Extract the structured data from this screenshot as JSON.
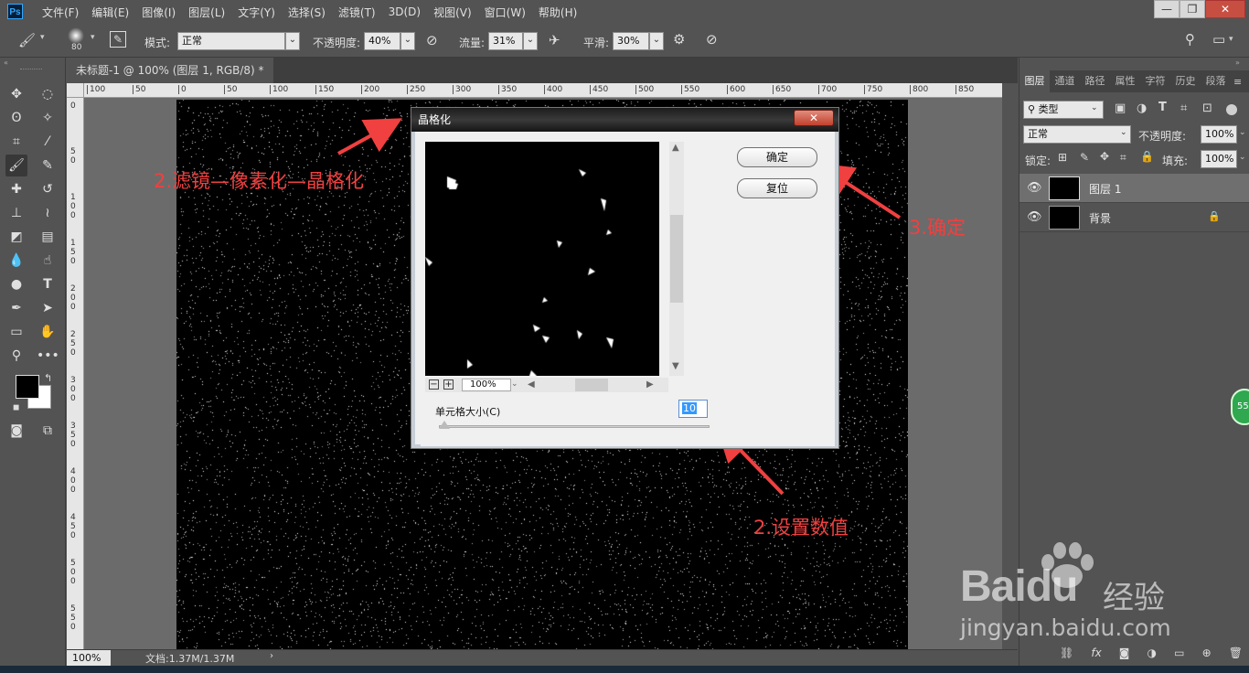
{
  "app": {
    "logo": "Ps",
    "menus": [
      "文件(F)",
      "编辑(E)",
      "图像(I)",
      "图层(L)",
      "文字(Y)",
      "选择(S)",
      "滤镜(T)",
      "3D(D)",
      "视图(V)",
      "窗口(W)",
      "帮助(H)"
    ],
    "window_controls": {
      "minimize": "—",
      "restore": "❐",
      "close": "✕"
    }
  },
  "options_bar": {
    "brush_size": "80",
    "mode_label": "模式:",
    "mode_value": "正常",
    "opacity_label": "不透明度:",
    "opacity_value": "40%",
    "flow_label": "流量:",
    "flow_value": "31%",
    "smooth_label": "平滑:",
    "smooth_value": "30%"
  },
  "document": {
    "tab_title": "未标题-1 @ 100% (图层 1, RGB/8) *",
    "tab_close": "×",
    "zoom": "100%",
    "doc_info": "文档:1.37M/1.37M",
    "ruler_top_labels": [
      "100",
      "50",
      "0",
      "50",
      "100",
      "150",
      "200",
      "250",
      "300",
      "350",
      "400",
      "450",
      "500",
      "550",
      "600",
      "650",
      "700",
      "750",
      "800",
      "850"
    ],
    "ruler_left_labels": [
      "0",
      "5\n0",
      "1\n0\n0",
      "1\n5\n0",
      "2\n0\n0",
      "2\n5\n0",
      "3\n0\n0",
      "3\n5\n0",
      "4\n0\n0",
      "4\n5\n0",
      "5\n0\n0",
      "5\n5\n0"
    ]
  },
  "layers_panel": {
    "tabs": [
      "图层",
      "通道",
      "路径",
      "属性",
      "字符",
      "历史",
      "段落"
    ],
    "filter_label": "类型",
    "blend_mode": "正常",
    "opacity_label": "不透明度:",
    "opacity_value": "100%",
    "lock_label": "锁定:",
    "fill_label": "填充:",
    "fill_value": "100%",
    "layers": [
      {
        "name": "图层 1",
        "selected": true,
        "locked": false
      },
      {
        "name": "背景",
        "selected": false,
        "locked": true
      }
    ]
  },
  "dialog": {
    "title": "晶格化",
    "ok_label": "确定",
    "reset_label": "复位",
    "zoom_value": "100%",
    "cell_size_label": "单元格大小(C)",
    "cell_size_value": "10",
    "cell_size_fraction": 0.0
  },
  "annotations": {
    "filter_step": "2.滤镜—像素化—晶格化",
    "confirm_step": "3.确定",
    "value_step": "2.设置数值"
  },
  "watermark": {
    "brand": "Baidu",
    "brand_cn": "经验",
    "url": "jingyan.baidu.com"
  },
  "colors": {
    "ui_bg": "#535353",
    "canvas": "#000000",
    "annotation_red": "#f04040",
    "dialog_bg": "#f0f0f0"
  }
}
